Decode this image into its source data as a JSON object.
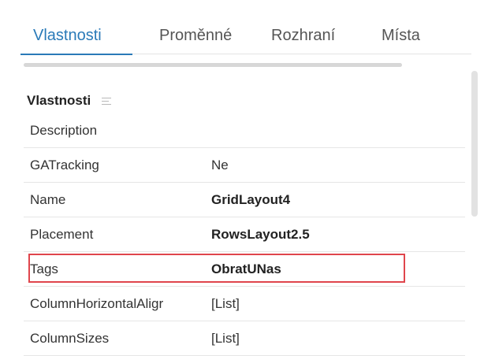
{
  "tabs": [
    {
      "label": "Vlastnosti",
      "active": true
    },
    {
      "label": "Proměnné",
      "active": false
    },
    {
      "label": "Rozhraní",
      "active": false
    },
    {
      "label": "Místa",
      "active": false
    }
  ],
  "section": {
    "title": "Vlastnosti",
    "sort_icon": "list-sort-icon"
  },
  "properties": [
    {
      "key": "Description",
      "value": "",
      "bold": false,
      "highlighted": false
    },
    {
      "key": "GATracking",
      "value": "Ne",
      "bold": false,
      "highlighted": false
    },
    {
      "key": "Name",
      "value": "GridLayout4",
      "bold": true,
      "highlighted": false
    },
    {
      "key": "Placement",
      "value": "RowsLayout2.5",
      "bold": true,
      "highlighted": false
    },
    {
      "key": "Tags",
      "value": "ObratUNas",
      "bold": true,
      "highlighted": true
    },
    {
      "key": "ColumnHorizontalAligr",
      "value": "[List]",
      "bold": false,
      "highlighted": false
    },
    {
      "key": "ColumnSizes",
      "value": "[List]",
      "bold": false,
      "highlighted": false
    }
  ],
  "colors": {
    "accent": "#2a7ab8",
    "highlight_border": "#e0454c"
  }
}
